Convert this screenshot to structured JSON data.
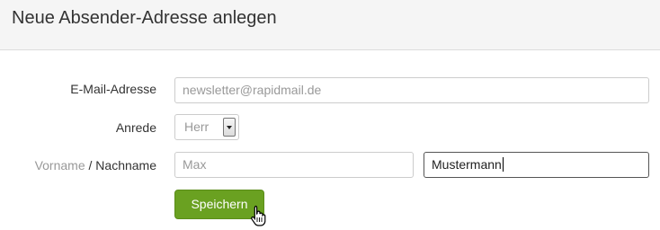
{
  "header": {
    "title": "Neue Absender-Adresse anlegen"
  },
  "form": {
    "email": {
      "label": "E-Mail-Adresse",
      "value": "newsletter@rapidmail.de"
    },
    "salutation": {
      "label": "Anrede",
      "value": "Herr"
    },
    "name": {
      "label_first": "Vorname",
      "separator": "/",
      "label_last": "Nachname",
      "first_value": "Max",
      "last_value": "Mustermann"
    },
    "save_label": "Speichern"
  },
  "colors": {
    "button": "#6aa121",
    "header_bg": "#f5f5f5"
  },
  "icons": {
    "cursor": "hand-pointer-icon",
    "select_arrow": "chevron-down-icon"
  }
}
